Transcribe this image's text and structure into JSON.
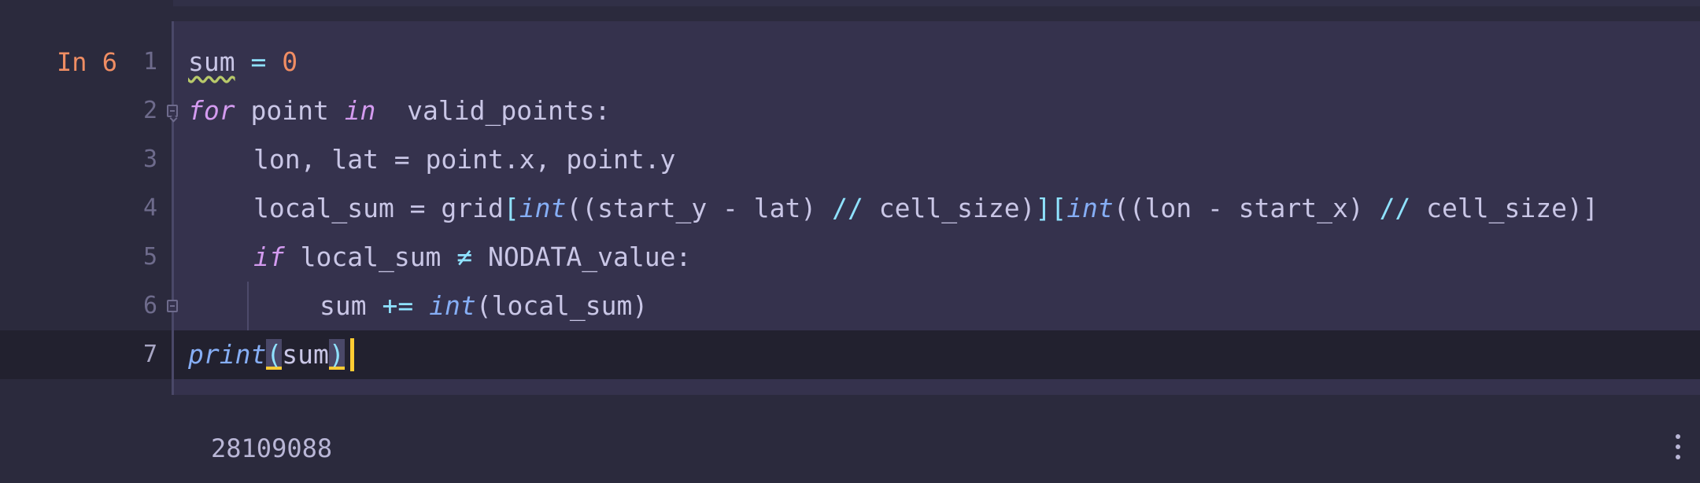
{
  "cell": {
    "prompt": "In 6",
    "line_numbers": [
      "1",
      "2",
      "3",
      "4",
      "5",
      "6",
      "7"
    ],
    "lines": {
      "l1": {
        "var": "sum",
        "eq": " = ",
        "zero": "0"
      },
      "l2": {
        "for": "for",
        "point": " point ",
        "in": "in",
        "rest": "  valid_points:"
      },
      "l3": {
        "text": "lon, lat = point.x, point.y"
      },
      "l4": {
        "a": "local_sum = grid",
        "b": "[",
        "c": "int",
        "d": "((start_y - lat) ",
        "e": "//",
        "f": " cell_size)",
        "g": "][",
        "h": "int",
        "i": "((lon - start_x) ",
        "j": "//",
        "k": " cell_size)]"
      },
      "l5": {
        "if": "if",
        "a": " local_sum ",
        "ne": "≠",
        "b": " NODATA_value:"
      },
      "l6": {
        "a": "sum ",
        "op": "+=",
        "sp": " ",
        "fn": "int",
        "rest": "(local_sum)"
      },
      "l7": {
        "fn": "print",
        "open": "(",
        "arg": "sum",
        "close": ")"
      }
    }
  },
  "output": {
    "value": "28109088"
  },
  "icons": {
    "fold": "fold-icon",
    "more": "more-options-icon"
  },
  "colors": {
    "keyword": "#d49bf0",
    "function": "#86aef5",
    "operator": "#8fe2ff",
    "number": "#f08d63",
    "caret": "#ffcc33"
  }
}
